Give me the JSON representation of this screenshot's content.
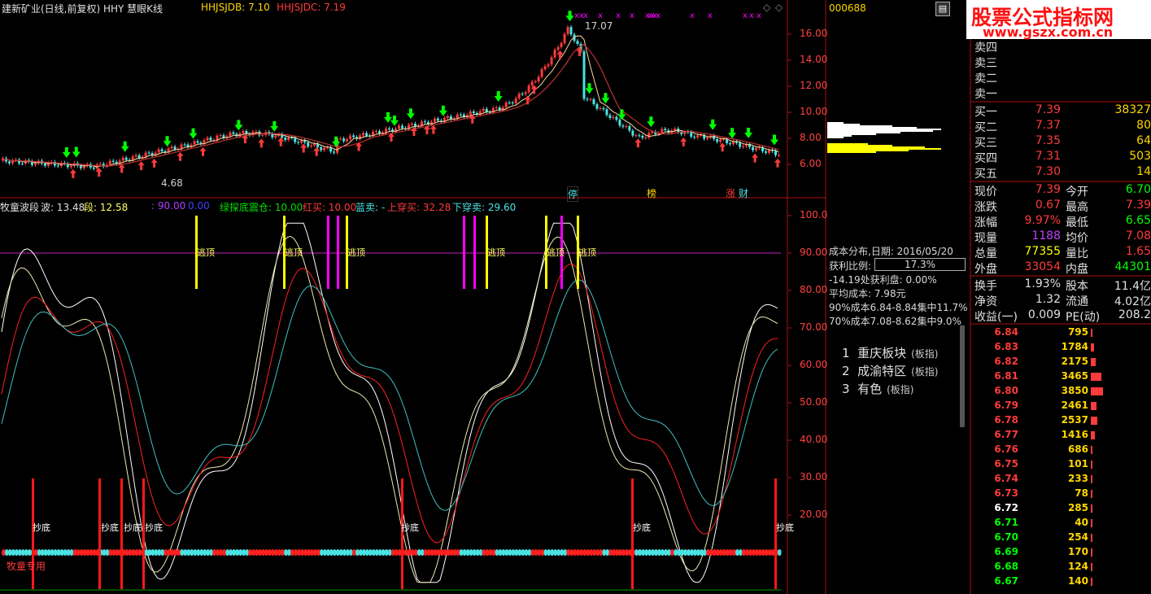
{
  "colors": {
    "up": "#ff3b3b",
    "down": "#4be2e2",
    "yellow": "#ffff00",
    "magenta": "#ff00ff",
    "white": "#ffffff",
    "green": "#00ff00",
    "axis": "#b01010",
    "text": "#c0c0c0"
  },
  "main_panel": {
    "title": "建新矿业(日线,前复权) HHY 慧眼K线",
    "ind1_label": "HHJSJDB: 7.10",
    "ind2_label": "HHJSJDC: 7.19",
    "peak_label": "17.07",
    "low_label": "4.68",
    "y_ticks": [
      "16.00",
      "14.00",
      "12.00",
      "10.00",
      "8.00",
      "6.00"
    ],
    "tags": [
      "停",
      "榜",
      "涨",
      "财"
    ]
  },
  "sub_panel": {
    "name": "牧童波段",
    "wave": "波: 13.48",
    "seg": "段: 12.58",
    "v90": ": 90.00",
    "v0": "0.00",
    "green_text": "绿探底震仓: 10.00",
    "red_buy": "红买: 10.00",
    "blue_sell": "蓝卖: -",
    "up_buy": "上穿买: 32.28",
    "down_sell": "下穿卖: 29.60",
    "y_ticks": [
      "100.0",
      "90.00",
      "80.00",
      "70.00",
      "60.00",
      "50.00",
      "40.00",
      "30.00",
      "20.00"
    ],
    "top_label": "逃顶",
    "bottom_label": "抄底",
    "footer_label": "牧童专用"
  },
  "chip": {
    "code": "000688",
    "date_line": "成本分布,日期: 2016/05/20",
    "profit_label": "获利比例:",
    "profit_value": "17.3%",
    "profit_line": "-14.19处获利盘: 0.00%",
    "avg_line": "平均成本: 7.98元",
    "c90": "90%成本6.84-8.84集中11.7%",
    "c70": "70%成本7.08-8.62集中9.0%"
  },
  "sectors": [
    {
      "num": "1",
      "name": "重庆板块",
      "tag": "(板指)"
    },
    {
      "num": "2",
      "name": "成渝特区",
      "tag": "(板指)"
    },
    {
      "num": "3",
      "name": "有色",
      "tag": "(板指)"
    }
  ],
  "watermark": {
    "title": "股票公式指标网",
    "url": "www.gszx.com.cn"
  },
  "order_book": {
    "sells": [
      "卖四",
      "卖三",
      "卖二",
      "卖一"
    ],
    "buys": [
      {
        "label": "买一",
        "price": "7.39",
        "vol": "38327"
      },
      {
        "label": "买二",
        "price": "7.37",
        "vol": "80"
      },
      {
        "label": "买三",
        "price": "7.35",
        "vol": "64"
      },
      {
        "label": "买四",
        "price": "7.31",
        "vol": "503"
      },
      {
        "label": "买五",
        "price": "7.30",
        "vol": "14"
      }
    ]
  },
  "stats": [
    {
      "l1": "现价",
      "v1": "7.39",
      "c1": "#ff3b3b",
      "l2": "今开",
      "v2": "6.70",
      "c2": "#00ff00"
    },
    {
      "l1": "涨跌",
      "v1": "0.67",
      "c1": "#ff3b3b",
      "l2": "最高",
      "v2": "7.39",
      "c2": "#ff3b3b"
    },
    {
      "l1": "涨幅",
      "v1": "9.97%",
      "c1": "#ff3b3b",
      "l2": "最低",
      "v2": "6.65",
      "c2": "#00ff00"
    },
    {
      "l1": "现量",
      "v1": "1188",
      "c1": "#c040ff",
      "l2": "均价",
      "v2": "7.08",
      "c2": "#ff3b3b"
    },
    {
      "l1": "总量",
      "v1": "77355",
      "c1": "#ffff00",
      "l2": "量比",
      "v2": "1.65",
      "c2": "#ff3b3b"
    },
    {
      "l1": "外盘",
      "v1": "33054",
      "c1": "#ff3b3b",
      "l2": "内盘",
      "v2": "44301",
      "c2": "#00ff00"
    },
    {
      "l1": "换手",
      "v1": "1.93%",
      "c1": "#e0e0e0",
      "l2": "股本",
      "v2": "11.4亿",
      "c2": "#e0e0e0"
    },
    {
      "l1": "净资",
      "v1": "1.32",
      "c1": "#e0e0e0",
      "l2": "流通",
      "v2": "4.02亿",
      "c2": "#e0e0e0"
    },
    {
      "l1": "收益(一)",
      "v1": "0.009",
      "c1": "#e0e0e0",
      "l2": "PE(动)",
      "v2": "208.2",
      "c2": "#e0e0e0"
    }
  ],
  "price_dist": [
    {
      "p": "6.84",
      "v": "795",
      "bar": 0.1
    },
    {
      "p": "6.83",
      "v": "1784",
      "bar": 0.24
    },
    {
      "p": "6.82",
      "v": "2175",
      "bar": 0.4
    },
    {
      "p": "6.81",
      "v": "3465",
      "bar": 0.85
    },
    {
      "p": "6.80",
      "v": "3850",
      "bar": 1.0
    },
    {
      "p": "6.79",
      "v": "2461",
      "bar": 0.45
    },
    {
      "p": "6.78",
      "v": "2537",
      "bar": 0.5
    },
    {
      "p": "6.77",
      "v": "1416",
      "bar": 0.35
    },
    {
      "p": "6.76",
      "v": "686",
      "bar": 0.12
    },
    {
      "p": "6.75",
      "v": "101",
      "bar": 0.04
    },
    {
      "p": "6.74",
      "v": "233",
      "bar": 0.06
    },
    {
      "p": "6.73",
      "v": "78",
      "bar": 0.04
    },
    {
      "p": "6.72",
      "v": "285",
      "bar": 0.06
    },
    {
      "p": "6.71",
      "v": "40",
      "bar": 0.03
    },
    {
      "p": "6.70",
      "v": "254",
      "bar": 0.06
    },
    {
      "p": "6.69",
      "v": "170",
      "bar": 0.05
    },
    {
      "p": "6.68",
      "v": "124",
      "bar": 0.04
    },
    {
      "p": "6.67",
      "v": "140",
      "bar": 0.04
    }
  ]
}
